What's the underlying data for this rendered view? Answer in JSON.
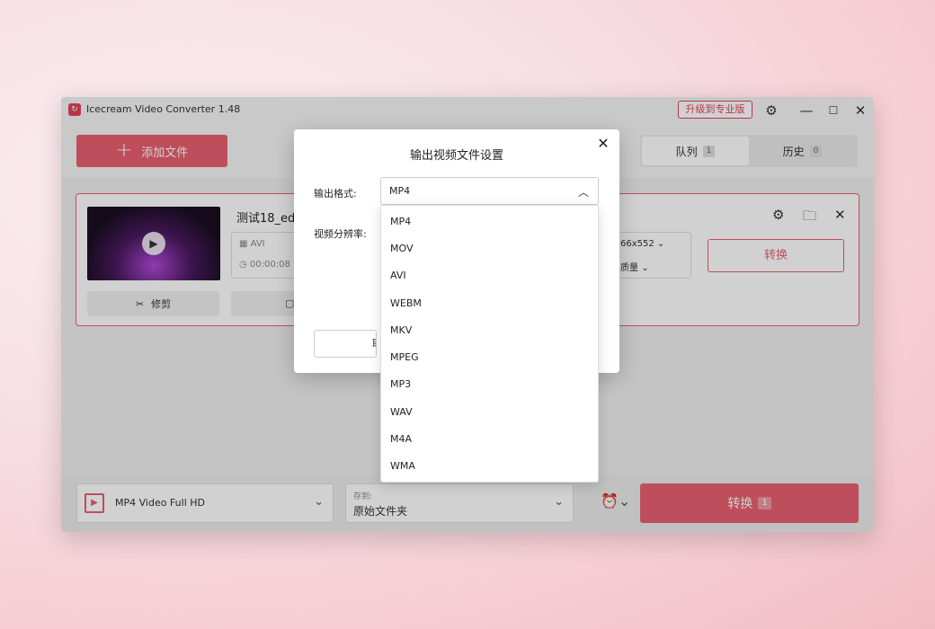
{
  "app": {
    "title": "Icecream Video Converter 1.48",
    "upgrade_label": "升级到专业版",
    "icons": [
      "settings-icon",
      "minimize-icon",
      "maximize-icon",
      "close-icon"
    ]
  },
  "toolbar": {
    "add_file_label": "添加文件",
    "tabs": [
      {
        "label": "队列",
        "count": "1"
      },
      {
        "label": "历史",
        "count": "0"
      }
    ]
  },
  "queue_item": {
    "file_name": "测试18_edit",
    "format": "AVI",
    "duration": "00:00:08",
    "resolution_partial": "66x552",
    "quality_partial": "质量",
    "trim_label": "修剪",
    "convert_label": "转换"
  },
  "bottom": {
    "preset": "MP4 Video Full HD",
    "save_to_label": "存到:",
    "save_to_value": "原始文件夹",
    "convert_label": "转换",
    "convert_count": "1"
  },
  "dialog": {
    "title": "输出视频文件设置",
    "format_label": "输出格式:",
    "resolution_label": "视频分辨率:",
    "selected_format": "MP4",
    "cancel_partial": "取",
    "options": [
      "MP4",
      "MOV",
      "AVI",
      "WEBM",
      "MKV",
      "MPEG",
      "MP3",
      "WAV",
      "M4A",
      "WMA"
    ]
  },
  "colors": {
    "accent": "#e8606f",
    "accent_dark": "#e0445b"
  }
}
